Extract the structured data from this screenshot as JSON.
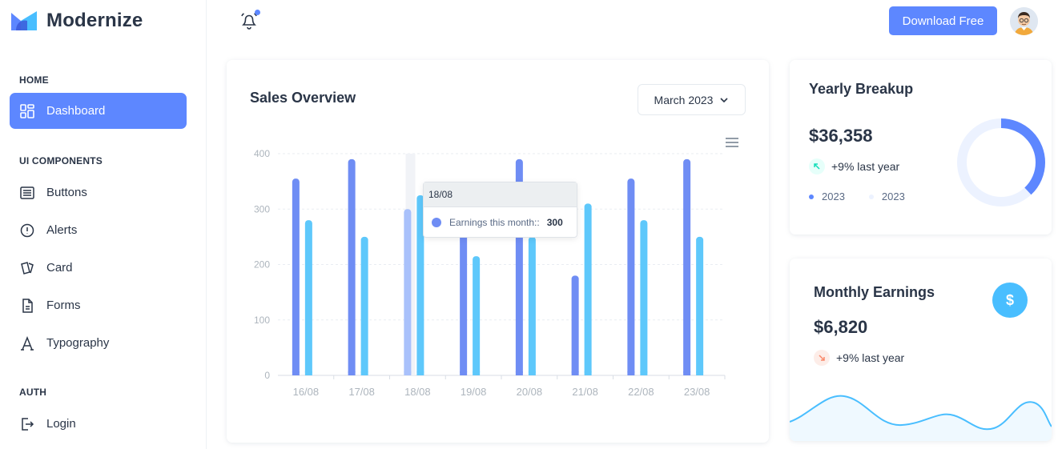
{
  "brand": {
    "name": "Modernize"
  },
  "sidebar": {
    "sections": [
      {
        "label": "HOME"
      },
      {
        "label": "UI COMPONENTS"
      },
      {
        "label": "AUTH"
      }
    ],
    "items": [
      {
        "label": "Dashboard",
        "icon": "dashboard-icon"
      },
      {
        "label": "Buttons",
        "icon": "article-icon"
      },
      {
        "label": "Alerts",
        "icon": "alert-circle-icon"
      },
      {
        "label": "Card",
        "icon": "cards-icon"
      },
      {
        "label": "Forms",
        "icon": "file-description-icon"
      },
      {
        "label": "Typography",
        "icon": "typography-icon"
      },
      {
        "label": "Login",
        "icon": "login-icon"
      }
    ]
  },
  "header": {
    "download_label": "Download Free"
  },
  "sales": {
    "title": "Sales Overview",
    "month": "March 2023",
    "tooltip": {
      "date": "18/08",
      "series": "Earnings this month::",
      "value": "300"
    }
  },
  "chart_data": {
    "type": "bar",
    "categories": [
      "16/08",
      "17/08",
      "18/08",
      "19/08",
      "20/08",
      "21/08",
      "22/08",
      "23/08"
    ],
    "series": [
      {
        "values": [
          355,
          390,
          300,
          300,
          390,
          180,
          355,
          390
        ],
        "color": "#6f8df4"
      },
      {
        "values": [
          280,
          250,
          325,
          215,
          250,
          310,
          280,
          250
        ],
        "color": "#5ec8fb"
      }
    ],
    "yticks": [
      "0",
      "100",
      "200",
      "300",
      "400"
    ],
    "ylim": [
      0,
      400
    ],
    "grid": true,
    "highlight_index": 2
  },
  "yearly": {
    "title": "Yearly Breakup",
    "value": "$36,358",
    "trend": "+9% last year",
    "legend": [
      {
        "label": "2023",
        "color": "#5d87ff"
      },
      {
        "label": "2023",
        "color": "#ecf2ff"
      }
    ],
    "donut": {
      "primary_fraction": 0.38,
      "primary_color": "#5d87ff",
      "secondary_color": "#ecf2ff"
    }
  },
  "monthly": {
    "title": "Monthly Earnings",
    "value": "$6,820",
    "trend": "+9% last year",
    "icon": "currency-dollar-icon",
    "dollar_symbol": "$"
  }
}
